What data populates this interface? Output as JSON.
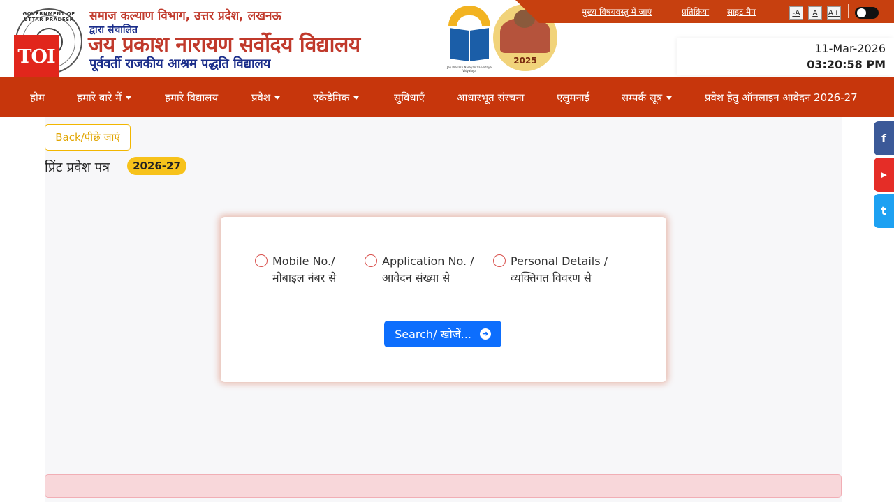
{
  "header": {
    "dept_line": "समाज कल्याण विभाग, उत्तर प्रदेश, लखनऊ",
    "operated_by": "द्वारा संचालित",
    "school_name": "जय प्रकाश नारायण सर्वोदय विद्यालय",
    "former_name": "पूर्ववर्ती राजकीय आश्रम पद्धति विद्यालय",
    "emblem_text": "GOVERNMENT OF UTTAR PRADESH",
    "logo_caption": "Jay Prakash Narayan Sarvodaya Vidyalaya",
    "kumbh_year": "2025",
    "toi_badge": "TOI"
  },
  "topbar": {
    "skip_link": "मुख्य विषयवस्तु में जाएं",
    "feedback_link": "प्रतिक्रिया",
    "sitemap_link": "साइट मैप",
    "font_decrease": "-A",
    "font_normal": "A",
    "font_increase": "A+"
  },
  "datetime": {
    "date": "11-Mar-2026",
    "time": "03:20:58 PM"
  },
  "nav": {
    "items": [
      {
        "label": "होम"
      },
      {
        "label": "हमारे बारे में"
      },
      {
        "label": "हमारे विद्यालय"
      },
      {
        "label": "प्रवेश"
      },
      {
        "label": "एकेडेमिक"
      },
      {
        "label": "सुविधाएँ"
      },
      {
        "label": "आधारभूत संरचना"
      },
      {
        "label": "एलुमनाई"
      },
      {
        "label": "सम्पर्क सूत्र"
      },
      {
        "label": "प्रवेश हेतु ऑनलाइन आवेदन 2026-27"
      }
    ]
  },
  "page": {
    "back_label": "Back/पीछे जाएं",
    "title": "प्रिंट प्रवेश पत्र",
    "year_badge": "2026-27"
  },
  "form": {
    "options": [
      {
        "line1": "Mobile No./",
        "line2": "मोबाइल नंबर से"
      },
      {
        "line1": "Application No. /",
        "line2": "आवेदन संख्या से"
      },
      {
        "line1": "Personal Details /",
        "line2": "व्यक्तिगत विवरण से"
      }
    ],
    "search_label": "Search/ खोजें...",
    "search_icon": "arrow-circle-right-icon"
  },
  "social": [
    {
      "name": "facebook",
      "glyph": "f",
      "color": "#3b5998"
    },
    {
      "name": "youtube",
      "glyph": "▶",
      "color": "#e52d27"
    },
    {
      "name": "twitter",
      "glyph": "t",
      "color": "#1da1f2"
    }
  ],
  "colors": {
    "nav_bg": "#c7360c",
    "accent_yellow": "#f7c21b",
    "primary_button": "#0d6efd",
    "alert_bg": "#f8d7da"
  }
}
